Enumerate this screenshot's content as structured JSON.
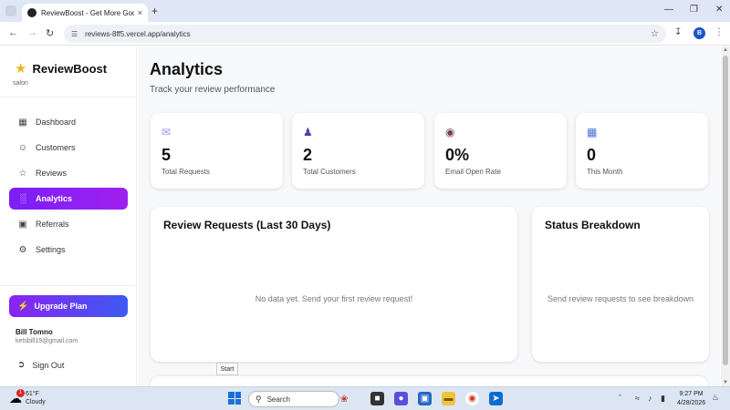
{
  "browser": {
    "tab_title": "ReviewBoost - Get More Google Reviews",
    "url": "reviews-8ff5.vercel.app/analytics",
    "profile_initial": "B",
    "new_tab_label": "+",
    "close_tab_label": "×"
  },
  "sidebar": {
    "brand": "ReviewBoost",
    "brand_sub": "salon",
    "items": [
      {
        "label": "Dashboard",
        "icon": "dashboard-icon"
      },
      {
        "label": "Customers",
        "icon": "users-icon"
      },
      {
        "label": "Reviews",
        "icon": "star-icon"
      },
      {
        "label": "Analytics",
        "icon": "bar-chart-icon",
        "active": true
      },
      {
        "label": "Referrals",
        "icon": "gift-icon"
      },
      {
        "label": "Settings",
        "icon": "gear-icon"
      }
    ],
    "upgrade_label": "Upgrade Plan",
    "user_name": "Bill Tomno",
    "user_email": "ketsbill19@gmail.com",
    "signout_label": "Sign Out"
  },
  "main": {
    "title": "Analytics",
    "subtitle": "Track your review performance",
    "stats": [
      {
        "value": "5",
        "label": "Total Requests",
        "icon": "envelope-icon"
      },
      {
        "value": "2",
        "label": "Total Customers",
        "icon": "people-icon"
      },
      {
        "value": "0%",
        "label": "Email Open Rate",
        "icon": "eye-icon"
      },
      {
        "value": "0",
        "label": "This Month",
        "icon": "calendar-icon"
      }
    ],
    "requests_panel": {
      "title": "Review Requests (Last 30 Days)",
      "empty": "No data yet. Send your first review request!"
    },
    "status_panel": {
      "title": "Status Breakdown",
      "empty": "Send review requests to see breakdown"
    }
  },
  "tooltip": "Start",
  "taskbar": {
    "temp": "61°F",
    "condition": "Cloudy",
    "weather_badge": "1",
    "search_label": "Search",
    "time": "9:27 PM",
    "date": "4/28/2026"
  }
}
